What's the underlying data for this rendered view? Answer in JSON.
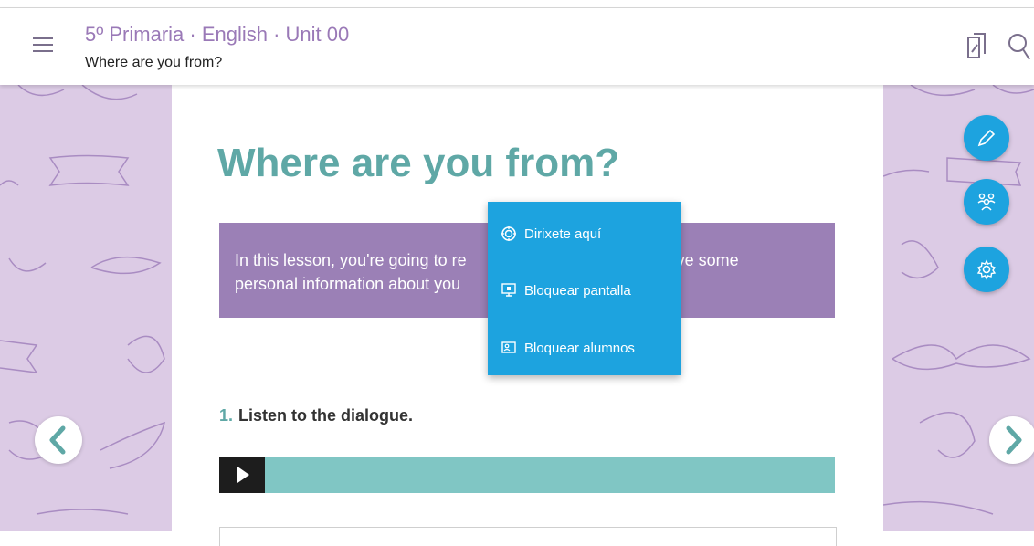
{
  "header": {
    "course_title": "5º Primaria · English · Unit 00",
    "lesson_subtitle": "Where are you from?",
    "icons": [
      "menu-icon",
      "pages-icon",
      "search-icon"
    ]
  },
  "lesson": {
    "title": "Where are you from?",
    "intro_line1_start": "In this lesson, you're going to re",
    "intro_line1_end": "ve some",
    "intro_line2_start": "personal information about you"
  },
  "exercise": {
    "number": "1.",
    "text": "Listen to the dialogue."
  },
  "popup_menu": {
    "items": [
      {
        "label": "Dirixete aquí",
        "icon": "target-icon"
      },
      {
        "label": "Bloquear pantalla",
        "icon": "monitor-lock-icon"
      },
      {
        "label": "Bloquear alumnos",
        "icon": "student-lock-icon"
      }
    ]
  },
  "toolbar": {
    "buttons": [
      "pencil-icon",
      "group-icon",
      "gear-icon"
    ]
  },
  "colors": {
    "accent_teal": "#5fa8a6",
    "purple": "#9b80b6",
    "popup_blue": "#1da3df",
    "background_pattern": "#dccbe5"
  }
}
